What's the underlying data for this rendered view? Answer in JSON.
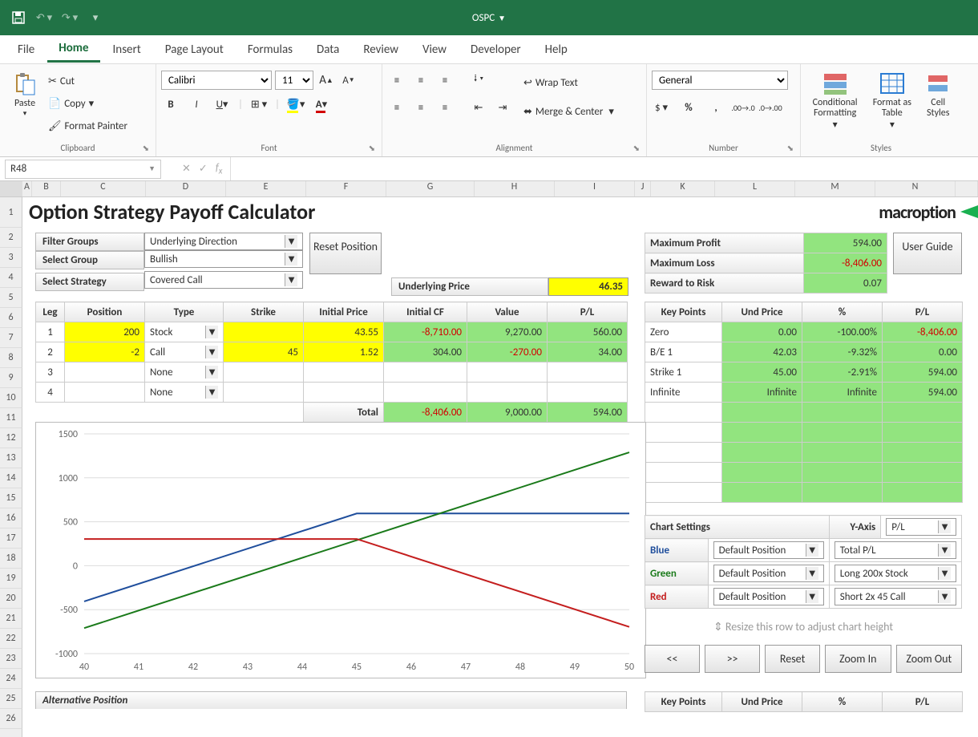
{
  "title": "OSPC",
  "menus": [
    "File",
    "Home",
    "Insert",
    "Page Layout",
    "Formulas",
    "Data",
    "Review",
    "View",
    "Developer",
    "Help"
  ],
  "ribbon": {
    "clipboard": {
      "label": "Clipboard",
      "paste": "Paste",
      "cut": "Cut",
      "copy": "Copy",
      "fp": "Format Painter"
    },
    "font": {
      "label": "Font",
      "name": "Calibri",
      "size": "11"
    },
    "alignment": {
      "label": "Alignment",
      "wrap": "Wrap Text",
      "merge": "Merge & Center"
    },
    "number": {
      "label": "Number",
      "format": "General"
    },
    "styles": {
      "label": "Styles",
      "cond": "Conditional Formatting",
      "fat": "Format as Table",
      "cell": "Cell Styles"
    }
  },
  "namebox": "R48",
  "page_title": "Option Strategy Payoff Calculator",
  "logo_text": "macroption",
  "filters": {
    "filter_groups_label": "Filter Groups",
    "filter_groups_value": "Underlying Direction",
    "select_group_label": "Select Group",
    "select_group_value": "Bullish",
    "select_strategy_label": "Select Strategy",
    "select_strategy_value": "Covered Call"
  },
  "reset_position": "Reset Position",
  "user_guide": "User Guide",
  "underlying_price_label": "Underlying Price",
  "underlying_price_value": "46.35",
  "summary": {
    "max_profit_label": "Maximum Profit",
    "max_profit": "594.00",
    "max_loss_label": "Maximum Loss",
    "max_loss": "-8,406.00",
    "rr_label": "Reward to Risk",
    "rr": "0.07"
  },
  "leg_headers": [
    "Leg",
    "Position",
    "Type",
    "Strike",
    "Initial Price",
    "Initial CF",
    "Value",
    "P/L"
  ],
  "legs": [
    {
      "n": "1",
      "pos": "200",
      "type": "Stock",
      "strike": "",
      "price": "43.55",
      "cf": "-8,710.00",
      "value": "9,270.00",
      "pl": "560.00"
    },
    {
      "n": "2",
      "pos": "-2",
      "type": "Call",
      "strike": "45",
      "price": "1.52",
      "cf": "304.00",
      "value": "-270.00",
      "pl": "34.00"
    },
    {
      "n": "3",
      "pos": "",
      "type": "None",
      "strike": "",
      "price": "",
      "cf": "",
      "value": "",
      "pl": ""
    },
    {
      "n": "4",
      "pos": "",
      "type": "None",
      "strike": "",
      "price": "",
      "cf": "",
      "value": "",
      "pl": ""
    }
  ],
  "total_label": "Total",
  "totals": {
    "cf": "-8,406.00",
    "value": "9,000.00",
    "pl": "594.00"
  },
  "kp_headers": [
    "Key Points",
    "Und Price",
    "%",
    "P/L"
  ],
  "key_points": [
    {
      "name": "Zero",
      "up": "0.00",
      "pct": "-100.00%",
      "pl": "-8,406.00"
    },
    {
      "name": "B/E 1",
      "up": "42.03",
      "pct": "-9.32%",
      "pl": "0.00"
    },
    {
      "name": "Strike 1",
      "up": "45.00",
      "pct": "-2.91%",
      "pl": "594.00"
    },
    {
      "name": "Infinite",
      "up": "Infinite",
      "pct": "Infinite",
      "pl": "594.00"
    }
  ],
  "chart_settings": {
    "label": "Chart Settings",
    "yaxis_label": "Y-Axis",
    "yaxis_value": "P/L",
    "blue_label": "Blue",
    "blue_pos": "Default Position",
    "blue_series": "Total P/L",
    "green_label": "Green",
    "green_pos": "Default Position",
    "green_series": "Long 200x Stock",
    "red_label": "Red",
    "red_pos": "Default Position",
    "red_series": "Short 2x 45 Call"
  },
  "resize_hint": "Resize this row to adjust chart height",
  "nav_buttons": [
    "<<",
    ">>",
    "Reset",
    "Zoom In",
    "Zoom Out"
  ],
  "alternative_position": "Alternative Position",
  "kp_headers2": [
    "Key Points",
    "Und Price",
    "%",
    "P/L"
  ],
  "chart_data": {
    "type": "line",
    "xlabel": "",
    "ylabel": "",
    "xlim": [
      40,
      50
    ],
    "ylim": [
      -1000,
      1500
    ],
    "x_ticks": [
      40,
      41,
      42,
      43,
      44,
      45,
      46,
      47,
      48,
      49,
      50
    ],
    "y_ticks": [
      -1000,
      -500,
      0,
      500,
      1000,
      1500
    ],
    "series": [
      {
        "name": "Total P/L",
        "color": "#1f4e9c",
        "x": [
          40,
          45,
          50
        ],
        "y": [
          -406,
          594,
          594
        ]
      },
      {
        "name": "Long 200x Stock",
        "color": "#1a7a1a",
        "x": [
          40,
          50
        ],
        "y": [
          -710,
          1290
        ]
      },
      {
        "name": "Short 2x 45 Call",
        "color": "#c41e1e",
        "x": [
          40,
          45,
          50
        ],
        "y": [
          304,
          304,
          -696
        ]
      }
    ]
  }
}
